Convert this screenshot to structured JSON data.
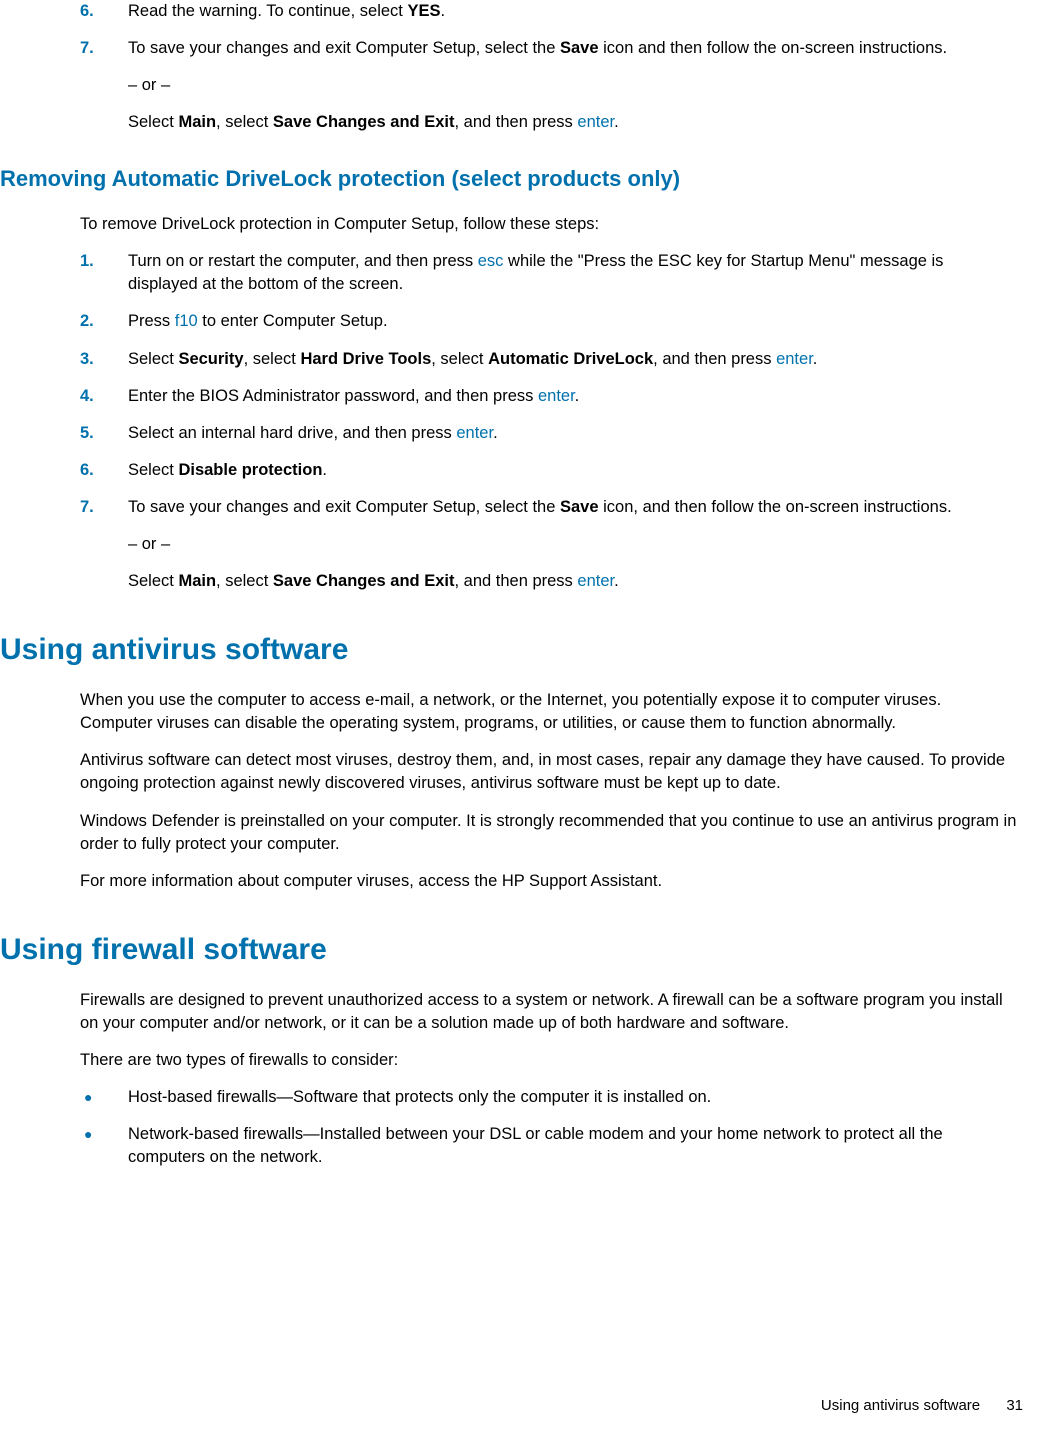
{
  "listA": {
    "item6": {
      "num": "6.",
      "a": "Read the warning. To continue, select ",
      "b": "YES",
      "c": "."
    },
    "item7": {
      "num": "7.",
      "a": "To save your changes and exit Computer Setup, select the ",
      "b": "Save",
      "c": " icon and then follow the on-screen instructions.",
      "or": "– or –",
      "d": "Select ",
      "e": "Main",
      "f": ", select ",
      "g": "Save Changes and Exit",
      "h": ", and then press ",
      "i": "enter",
      "j": "."
    }
  },
  "sectionB": {
    "title": "Removing Automatic DriveLock protection (select products only)",
    "intro": "To remove DriveLock protection in Computer Setup, follow these steps:",
    "s1": {
      "num": "1.",
      "a": "Turn on or restart the computer, and then press ",
      "b": "esc",
      "c": " while the \"Press the ESC key for Startup Menu\" message is displayed at the bottom of the screen."
    },
    "s2": {
      "num": "2.",
      "a": "Press ",
      "b": "f10",
      "c": " to enter Computer Setup."
    },
    "s3": {
      "num": "3.",
      "a": "Select ",
      "b": "Security",
      "c": ", select ",
      "d": "Hard Drive Tools",
      "e": ", select ",
      "f": "Automatic DriveLock",
      "g": ", and then press ",
      "h": "enter",
      "i": "."
    },
    "s4": {
      "num": "4.",
      "a": "Enter the BIOS Administrator password, and then press ",
      "b": "enter",
      "c": "."
    },
    "s5": {
      "num": "5.",
      "a": "Select an internal hard drive, and then press ",
      "b": "enter",
      "c": "."
    },
    "s6": {
      "num": "6.",
      "a": "Select ",
      "b": "Disable protection",
      "c": "."
    },
    "s7": {
      "num": "7.",
      "a": "To save your changes and exit Computer Setup, select the ",
      "b": "Save",
      "c": " icon, and then follow the on-screen instructions.",
      "or": "– or –",
      "d": "Select ",
      "e": "Main",
      "f": ", select ",
      "g": "Save Changes and Exit",
      "h": ", and then press ",
      "i": "enter",
      "j": "."
    }
  },
  "sectionC": {
    "title": "Using antivirus software",
    "p1": "When you use the computer to access e-mail, a network, or the Internet, you potentially expose it to computer viruses. Computer viruses can disable the operating system, programs, or utilities, or cause them to function abnormally.",
    "p2": "Antivirus software can detect most viruses, destroy them, and, in most cases, repair any damage they have caused. To provide ongoing protection against newly discovered viruses, antivirus software must be kept up to date.",
    "p3": "Windows Defender is preinstalled on your computer. It is strongly recommended that you continue to use an antivirus program in order to fully protect your computer.",
    "p4": "For more information about computer viruses, access the HP Support Assistant."
  },
  "sectionD": {
    "title": "Using firewall software",
    "p1": "Firewalls are designed to prevent unauthorized access to a system or network. A firewall can be a software program you install on your computer and/or network, or it can be a solution made up of both hardware and software.",
    "p2": "There are two types of firewalls to consider:",
    "b1": "Host-based firewalls—Software that protects only the computer it is installed on.",
    "b2": "Network-based firewalls—Installed between your DSL or cable modem and your home network to protect all the computers on the network."
  },
  "footer": {
    "label": "Using antivirus software",
    "page": "31"
  }
}
